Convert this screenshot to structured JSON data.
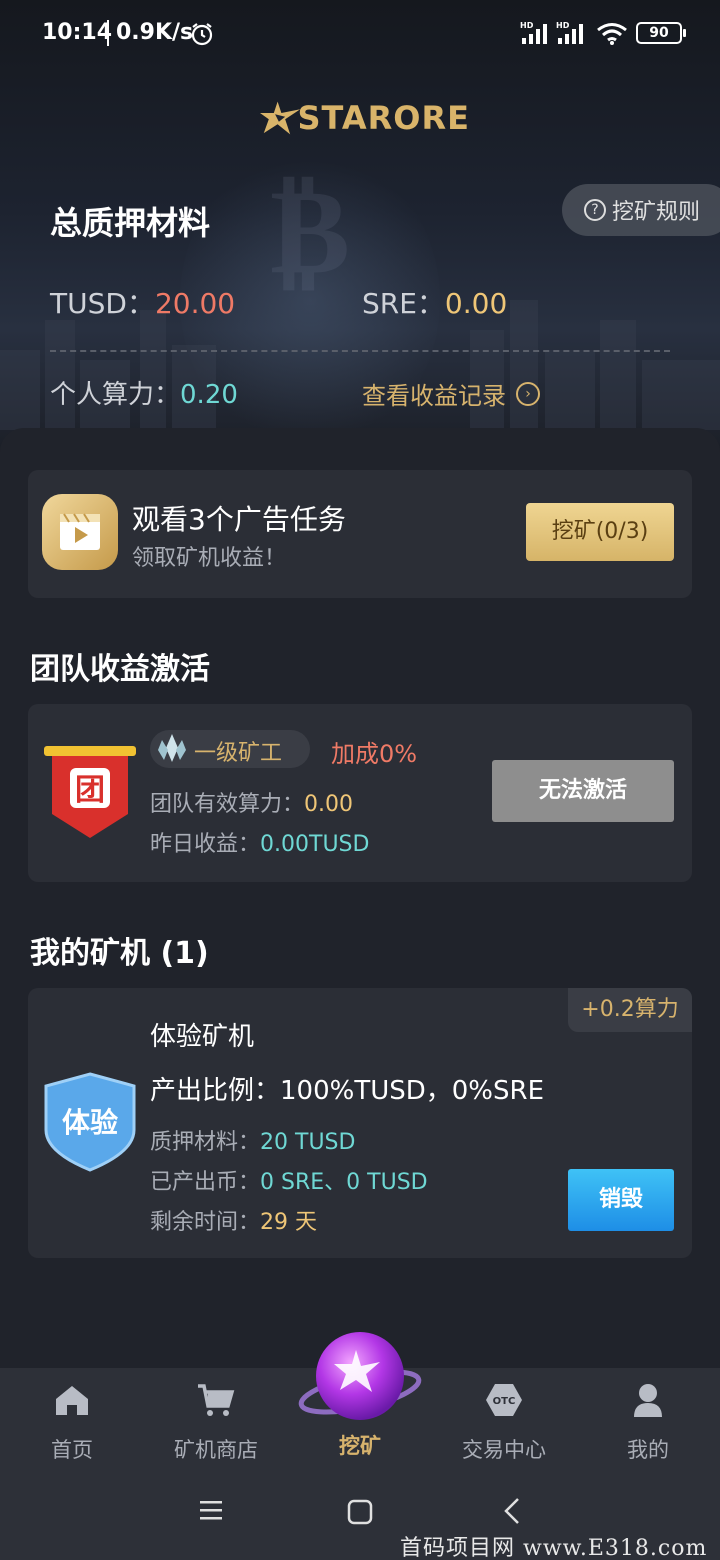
{
  "status_bar": {
    "time": "10:14",
    "net_speed": "0.9K/s",
    "battery": "90",
    "signal_label": "HD"
  },
  "brand": {
    "logo_text": "STARORE"
  },
  "summary": {
    "title": "总质押材料",
    "rules_label": "挖矿规则",
    "tusd_label": "TUSD：",
    "tusd_value": "20.00",
    "sre_label": "SRE：",
    "sre_value": "0.00",
    "power_label": "个人算力：",
    "power_value": "0.20",
    "records_link": "查看收益记录"
  },
  "ad_task": {
    "title": "观看3个广告任务",
    "subtitle": "领取矿机收益！",
    "button": "挖矿(0/3)"
  },
  "team": {
    "section_title": "团队收益激活",
    "badge_char": "团",
    "level": "一级矿工",
    "bonus": "加成0%",
    "power_label": "团队有效算力：",
    "power_value": "0.00",
    "yday_label": "昨日收益：",
    "yday_value": "0.00TUSD",
    "activate_button": "无法激活"
  },
  "machines": {
    "section_title": "我的矿机 (1)",
    "items": [
      {
        "badge_text": "体验",
        "tag": "+0.2算力",
        "name": "体验矿机",
        "ratio": "产出比例：100%TUSD，0%SRE",
        "pledge_label": "质押材料：",
        "pledge_value": "20 TUSD",
        "produced_label": "已产出币：",
        "produced_value": "0 SRE、0 TUSD",
        "remaining_label": "剩余时间：",
        "remaining_value": "29 天",
        "action_button": "销毁"
      }
    ]
  },
  "bottom_nav": {
    "items": [
      {
        "label": "首页",
        "icon": "home-icon"
      },
      {
        "label": "矿机商店",
        "icon": "cart-icon"
      },
      {
        "label": "挖矿",
        "icon": "planet-icon",
        "active": true
      },
      {
        "label": "交易中心",
        "icon": "otc-icon"
      },
      {
        "label": "我的",
        "icon": "user-icon"
      }
    ],
    "otc_text": "OTC"
  },
  "watermark": "首码项目网 www.E318.com",
  "colors": {
    "accent_gold": "#d7b36d",
    "value_cyan": "#6fd8d4",
    "value_red": "#ef7a66",
    "value_yellow": "#efc677",
    "destroy_blue": "#1e8ee6"
  }
}
